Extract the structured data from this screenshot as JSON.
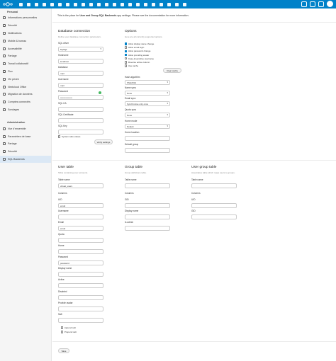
{
  "sidebar": {
    "personal_heading": "Personal",
    "personal_items": [
      {
        "label": "Informations personnelles",
        "icon": "person-icon"
      },
      {
        "label": "Sécurité",
        "icon": "lock-icon"
      },
      {
        "label": "Notifications",
        "icon": "bell-icon"
      },
      {
        "label": "Mobile & bureau",
        "icon": "phone-icon"
      },
      {
        "label": "Accessibilité",
        "icon": "accessibility-icon"
      },
      {
        "label": "Partage",
        "icon": "share-icon"
      },
      {
        "label": "Travail collaboratif",
        "icon": "collaboration-icon"
      },
      {
        "label": "Flux",
        "icon": "flux-icon"
      },
      {
        "label": "Vie privée",
        "icon": "privacy-icon"
      },
      {
        "label": "Nextcloud Office",
        "icon": "office-icon"
      },
      {
        "label": "Migration de données",
        "icon": "migration-icon"
      },
      {
        "label": "Comptes connectés",
        "icon": "link-icon"
      },
      {
        "label": "Sondages",
        "icon": "poll-icon"
      }
    ],
    "admin_heading": "Administration",
    "admin_items": [
      {
        "label": "Vue d'ensemble",
        "icon": "overview-icon"
      },
      {
        "label": "Paramètres de base",
        "icon": "gear-icon"
      },
      {
        "label": "Partage",
        "icon": "share-icon"
      },
      {
        "label": "Sécurité",
        "icon": "lock-icon"
      },
      {
        "label": "SQL Backends",
        "icon": "database-icon"
      }
    ]
  },
  "notice": {
    "prefix": "This is the place for ",
    "bold": "User and Group SQL Backends",
    "suffix": " app settings. Please see the documentation for more information."
  },
  "db": {
    "title": "Database connection",
    "hint": "Define your database connection parameters.",
    "driver_label": "SQL driver",
    "driver_value": "MySQL",
    "hostname_label": "Hostname",
    "hostname_value": "localhost",
    "database_label": "Database",
    "database_value": "mail",
    "username_label": "Username",
    "username_value": "mail",
    "password_label": "Password",
    "password_value": "••••••••••••••••",
    "sslca_label": "SQL CA",
    "sslcert_label": "SQL Certificate",
    "sslkey_label": "SQL Key",
    "system_wide": "System wide values",
    "verify_button": "Verify settings"
  },
  "options": {
    "title": "Options",
    "hint": "Here are all currently supported options.",
    "checkboxes": [
      {
        "label": "Allow display name change",
        "checked": true
      },
      {
        "label": "Allow email login",
        "checked": false
      },
      {
        "label": "Allow password change",
        "checked": true
      },
      {
        "label": "Allow providing avatar",
        "checked": true
      },
      {
        "label": "Case-insensitive username",
        "checked": false
      },
      {
        "label": "Reverse active column",
        "checked": false
      },
      {
        "label": "Use cache",
        "checked": false
      }
    ],
    "clear_cache": "Clear cache",
    "hash_label": "Hash algorithm",
    "hash_value": "SSHA512",
    "name_sync_label": "Name sync",
    "name_sync_value": "None",
    "email_sync_label": "Email sync",
    "email_sync_value": "Synchronise only once",
    "quota_sync_label": "Quota sync",
    "quota_sync_value": "None",
    "home_mode_label": "Home mode",
    "home_mode_value": "Default",
    "home_location_label": "Home location",
    "default_group_label": "Default group"
  },
  "user_table": {
    "title": "User table",
    "hint": "Table containing user accounts.",
    "name_label": "Table name",
    "name_value": "virtual_users",
    "columns_label": "Columns",
    "fields": [
      {
        "label": "UID",
        "value": "email"
      },
      {
        "label": "Username",
        "value": ""
      },
      {
        "label": "Email",
        "value": "email"
      },
      {
        "label": "Quota",
        "value": ""
      },
      {
        "label": "Home",
        "value": ""
      },
      {
        "label": "Password",
        "value": "password"
      },
      {
        "label": "Display name",
        "value": ""
      },
      {
        "label": "Active",
        "value": ""
      },
      {
        "label": "Disabled",
        "value": ""
      },
      {
        "label": "Provide avatar",
        "value": ""
      },
      {
        "label": "Salt",
        "value": ""
      }
    ],
    "append_salt": "Append salt",
    "prepend_salt": "Prepend salt"
  },
  "group_table": {
    "title": "Group table",
    "hint": "Group definitions table.",
    "name_label": "Table name",
    "columns_label": "Columns",
    "fields": [
      {
        "label": "GID"
      },
      {
        "label": "Display name"
      },
      {
        "label": "Is admin"
      }
    ]
  },
  "user_group_table": {
    "title": "User group table",
    "hint": "Associative table which maps users to groups.",
    "name_label": "Table name",
    "columns_label": "Columns",
    "fields": [
      {
        "label": "UID"
      },
      {
        "label": "GID"
      }
    ]
  },
  "save_button": "Save"
}
